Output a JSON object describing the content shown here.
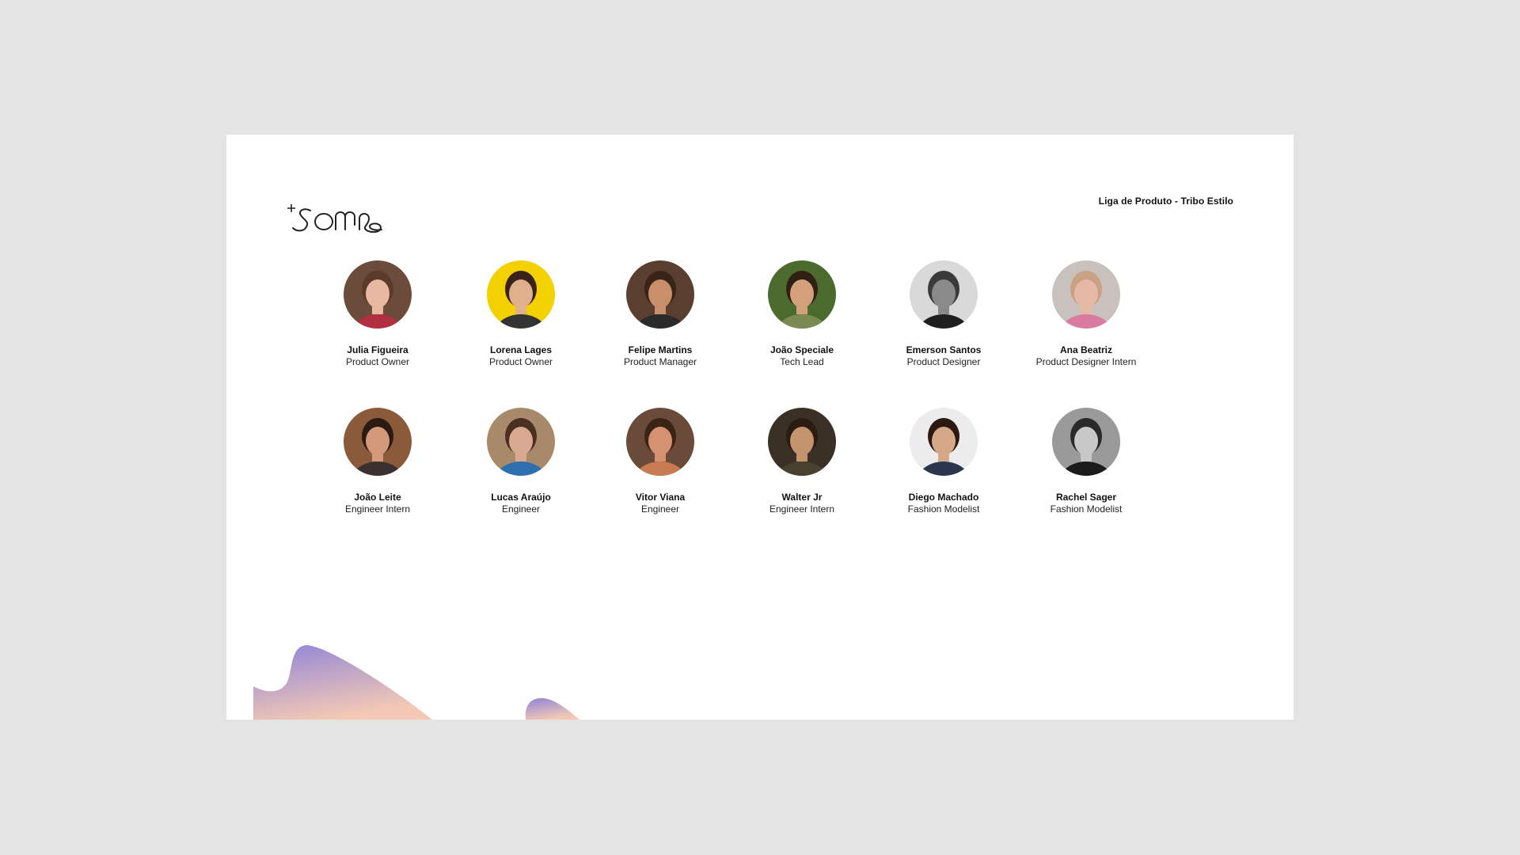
{
  "brand": {
    "logo_text": "+soma",
    "header_title": "Liga de Produto - Tribo Estilo"
  },
  "colors": {
    "background": "#e4e4e4",
    "slide": "#ffffff",
    "blob_top": "#8f84d8",
    "blob_bottom": "#f3c9b5"
  },
  "team": [
    {
      "name": "Julia Figueira",
      "role": "Product Owner",
      "avatar": {
        "bg": "#6b4b3a",
        "skin": "#e8b9a0",
        "hair": "#5a3a28",
        "shirt": "#b03040"
      }
    },
    {
      "name": "Lorena Lages",
      "role": "Product Owner",
      "avatar": {
        "bg": "#f3d000",
        "skin": "#e0b08c",
        "hair": "#3a2218",
        "shirt": "#333333"
      }
    },
    {
      "name": "Felipe Martins",
      "role": "Product Manager",
      "avatar": {
        "bg": "#5a3e30",
        "skin": "#c98e6a",
        "hair": "#3a2418",
        "shirt": "#2a2a2a"
      }
    },
    {
      "name": "João Speciale",
      "role": "Tech Lead",
      "avatar": {
        "bg": "#4b6b2e",
        "skin": "#d3a07c",
        "hair": "#2e2015",
        "shirt": "#7a8a50"
      }
    },
    {
      "name": "Emerson Santos",
      "role": "Product Designer",
      "avatar": {
        "bg": "#d9d9d9",
        "skin": "#8a8a8a",
        "hair": "#3a3a3a",
        "shirt": "#1f1f1f"
      }
    },
    {
      "name": "Ana Beatriz",
      "role": "Product Designer Intern",
      "avatar": {
        "bg": "#c9c1bd",
        "skin": "#e6b8a6",
        "hair": "#c9a184",
        "shirt": "#d97aa0"
      }
    },
    {
      "name": "João Leite",
      "role": "Engineer Intern",
      "avatar": {
        "bg": "#8a5a3a",
        "skin": "#d29a7a",
        "hair": "#2a1a12",
        "shirt": "#3a3030"
      }
    },
    {
      "name": "Lucas Araújo",
      "role": "Engineer",
      "avatar": {
        "bg": "#a88a6a",
        "skin": "#d8a890",
        "hair": "#4a3020",
        "shirt": "#2e6fb0"
      }
    },
    {
      "name": "Vitor Viana",
      "role": "Engineer",
      "avatar": {
        "bg": "#6a4a38",
        "skin": "#d49272",
        "hair": "#3a2416",
        "shirt": "#c87a50"
      }
    },
    {
      "name": "Walter Jr",
      "role": "Engineer Intern",
      "avatar": {
        "bg": "#3a3026",
        "skin": "#c4946e",
        "hair": "#2a1c12",
        "shirt": "#4a4030"
      }
    },
    {
      "name": "Diego Machado",
      "role": "Fashion Modelist",
      "avatar": {
        "bg": "#ececec",
        "skin": "#d5a888",
        "hair": "#2a1a12",
        "shirt": "#2a3650"
      }
    },
    {
      "name": "Rachel Sager",
      "role": "Fashion Modelist",
      "avatar": {
        "bg": "#9a9a9a",
        "skin": "#c8c8c8",
        "hair": "#2a2a2a",
        "shirt": "#1a1a1a"
      }
    }
  ]
}
